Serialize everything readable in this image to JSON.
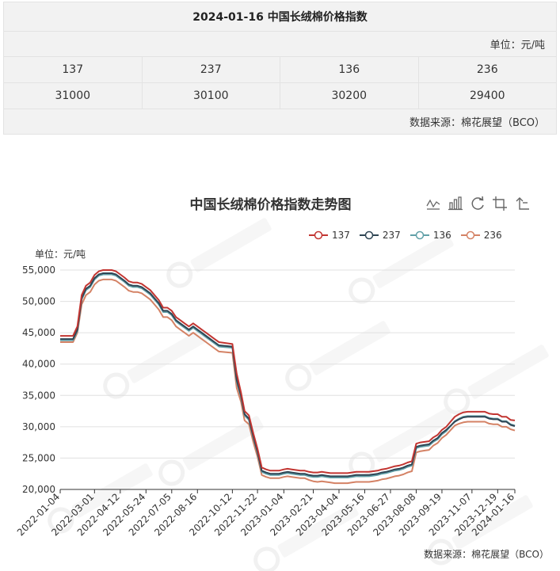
{
  "table": {
    "title": "2024-01-16 中国长绒棉价格指数",
    "unit": "单位：元/吨",
    "codes": [
      "137",
      "237",
      "136",
      "236"
    ],
    "values": [
      "31000",
      "30100",
      "30200",
      "29400"
    ],
    "source": "数据来源：棉花展望（BCO）"
  },
  "toolbox": {
    "icons": [
      "line-chart-icon",
      "bar-chart-icon",
      "restore-icon",
      "data-zoom-icon",
      "zoom-reset-icon"
    ]
  },
  "chart_data": {
    "type": "line",
    "title": "中国长绒棉价格指数走势图",
    "ylabel": "单位：元/吨",
    "source": "数据来源：棉花展望（BCO）",
    "ylim": [
      20000,
      55000
    ],
    "yticks": [
      "20,000",
      "25,000",
      "30,000",
      "35,000",
      "40,000",
      "45,000",
      "50,000",
      "55,000"
    ],
    "x_ticks": [
      "2022-01-04",
      "2022-03-01",
      "2022-04-12",
      "2022-05-24",
      "2022-07-05",
      "2022-08-16",
      "2022-10-12",
      "2022-11-22",
      "2023-01-04",
      "2023-02-21",
      "2023-04-04",
      "2023-05-16",
      "2023-06-27",
      "2023-08-08",
      "2023-09-19",
      "2023-11-07",
      "2023-12-19",
      "2024-01-16"
    ],
    "grid": true,
    "legend_position": "top-right",
    "colors": {
      "137": "#c23531",
      "237": "#2f4554",
      "136": "#61a0a8",
      "236": "#d48265"
    },
    "x": [
      "2022-01-04",
      "2022-01-18",
      "2022-01-25",
      "2022-02-01",
      "2022-02-08",
      "2022-02-15",
      "2022-02-22",
      "2022-03-01",
      "2022-03-08",
      "2022-03-15",
      "2022-03-22",
      "2022-03-29",
      "2022-04-05",
      "2022-04-12",
      "2022-04-19",
      "2022-04-26",
      "2022-05-03",
      "2022-05-10",
      "2022-05-17",
      "2022-05-24",
      "2022-05-31",
      "2022-06-07",
      "2022-06-14",
      "2022-06-21",
      "2022-06-28",
      "2022-07-05",
      "2022-07-12",
      "2022-07-19",
      "2022-07-26",
      "2022-08-02",
      "2022-08-09",
      "2022-08-16",
      "2022-08-23",
      "2022-08-30",
      "2022-09-06",
      "2022-09-13",
      "2022-09-20",
      "2022-10-12",
      "2022-10-19",
      "2022-10-26",
      "2022-11-01",
      "2022-11-08",
      "2022-11-15",
      "2022-11-22",
      "2022-11-29",
      "2022-12-06",
      "2022-12-13",
      "2022-12-20",
      "2022-12-27",
      "2023-01-04",
      "2023-01-10",
      "2023-01-17",
      "2023-01-31",
      "2023-02-07",
      "2023-02-14",
      "2023-02-21",
      "2023-02-28",
      "2023-03-07",
      "2023-03-14",
      "2023-03-21",
      "2023-03-28",
      "2023-04-04",
      "2023-04-11",
      "2023-04-18",
      "2023-04-25",
      "2023-05-02",
      "2023-05-09",
      "2023-05-16",
      "2023-05-23",
      "2023-05-30",
      "2023-06-06",
      "2023-06-13",
      "2023-06-20",
      "2023-06-27",
      "2023-07-04",
      "2023-07-11",
      "2023-07-18",
      "2023-07-25",
      "2023-08-01",
      "2023-08-08",
      "2023-08-15",
      "2023-08-22",
      "2023-08-29",
      "2023-09-05",
      "2023-09-12",
      "2023-09-19",
      "2023-09-26",
      "2023-10-10",
      "2023-10-17",
      "2023-10-24",
      "2023-10-31",
      "2023-11-07",
      "2023-11-14",
      "2023-11-21",
      "2023-11-28",
      "2023-12-05",
      "2023-12-12",
      "2023-12-19",
      "2023-12-26",
      "2024-01-02",
      "2024-01-09",
      "2024-01-16"
    ],
    "series": [
      {
        "name": "137",
        "values": [
          44500,
          44500,
          44500,
          46000,
          51000,
          52500,
          53000,
          54200,
          54800,
          55000,
          55000,
          55000,
          54800,
          54300,
          53800,
          53200,
          53000,
          53000,
          52800,
          52300,
          51800,
          51000,
          50200,
          49000,
          49000,
          48500,
          47500,
          47000,
          46500,
          46000,
          46500,
          46000,
          45500,
          45000,
          44500,
          44000,
          43500,
          43200,
          38500,
          35500,
          32500,
          31800,
          29000,
          26500,
          23500,
          23200,
          23000,
          23000,
          23000,
          23200,
          23300,
          23200,
          23000,
          23000,
          22800,
          22700,
          22700,
          22800,
          22700,
          22600,
          22600,
          22600,
          22600,
          22600,
          22700,
          22800,
          22800,
          22800,
          22800,
          22900,
          23000,
          23200,
          23300,
          23500,
          23700,
          23800,
          24000,
          24300,
          24500,
          27300,
          27500,
          27600,
          27700,
          28300,
          28700,
          29500,
          30000,
          31600,
          32000,
          32300,
          32400,
          32400,
          32400,
          32400,
          32400,
          32100,
          32000,
          32000,
          31600,
          31600,
          31100,
          31000
        ]
      },
      {
        "name": "237",
        "values": [
          44000,
          44000,
          44000,
          45500,
          50500,
          52000,
          52500,
          53700,
          54300,
          54500,
          54500,
          54500,
          54300,
          53800,
          53300,
          52700,
          52500,
          52500,
          52300,
          51800,
          51300,
          50500,
          49700,
          48500,
          48500,
          48000,
          47000,
          46500,
          46000,
          45500,
          46000,
          45500,
          45000,
          44500,
          44000,
          43500,
          43000,
          42800,
          37500,
          35000,
          32000,
          31300,
          28500,
          26000,
          23000,
          22700,
          22500,
          22500,
          22500,
          22700,
          22800,
          22700,
          22500,
          22500,
          22300,
          22200,
          22200,
          22300,
          22200,
          22100,
          22100,
          22100,
          22100,
          22100,
          22200,
          22300,
          22300,
          22300,
          22300,
          22400,
          22500,
          22700,
          22800,
          23000,
          23200,
          23300,
          23500,
          23800,
          24000,
          26800,
          27000,
          27100,
          27200,
          27800,
          28200,
          29000,
          29500,
          30800,
          31200,
          31500,
          31600,
          31600,
          31600,
          31600,
          31600,
          31300,
          31200,
          31200,
          30800,
          30800,
          30300,
          30100
        ]
      },
      {
        "name": "136",
        "values": [
          43800,
          43800,
          43800,
          45300,
          50300,
          51800,
          52300,
          53500,
          54100,
          54300,
          54300,
          54300,
          54100,
          53600,
          53100,
          52500,
          52300,
          52300,
          52100,
          51600,
          51100,
          50300,
          49500,
          48300,
          48300,
          47800,
          46800,
          46300,
          45800,
          45300,
          45800,
          45300,
          44800,
          44300,
          43800,
          43300,
          42800,
          42600,
          37200,
          34800,
          31800,
          31100,
          28300,
          25800,
          22800,
          22500,
          22300,
          22300,
          22300,
          22500,
          22600,
          22500,
          22300,
          22300,
          22100,
          22000,
          22000,
          22100,
          22000,
          21900,
          21900,
          21900,
          21900,
          21900,
          22000,
          22100,
          22100,
          22100,
          22100,
          22200,
          22300,
          22500,
          22600,
          22800,
          23000,
          23100,
          23300,
          23600,
          23800,
          26600,
          26800,
          26900,
          27000,
          27600,
          28000,
          28800,
          29300,
          30900,
          31300,
          31600,
          31700,
          31700,
          31700,
          31700,
          31700,
          31400,
          31300,
          31300,
          30900,
          30900,
          30400,
          30200
        ]
      },
      {
        "name": "236",
        "values": [
          43500,
          43500,
          43500,
          45000,
          49500,
          51000,
          51500,
          52700,
          53300,
          53500,
          53500,
          53500,
          53300,
          52800,
          52300,
          51700,
          51500,
          51500,
          51300,
          50800,
          50300,
          49500,
          48700,
          47500,
          47500,
          47000,
          46000,
          45500,
          45000,
          44500,
          45000,
          44500,
          44000,
          43500,
          43000,
          42500,
          42000,
          41800,
          36200,
          34000,
          31000,
          30400,
          27600,
          25200,
          22300,
          22000,
          21800,
          21800,
          21800,
          22000,
          22100,
          22000,
          21800,
          21800,
          21500,
          21300,
          21200,
          21300,
          21200,
          21100,
          21000,
          21000,
          21000,
          21000,
          21100,
          21200,
          21200,
          21200,
          21200,
          21300,
          21400,
          21600,
          21700,
          21900,
          22100,
          22200,
          22400,
          22700,
          22900,
          25900,
          26100,
          26200,
          26300,
          27000,
          27400,
          28200,
          28700,
          30200,
          30500,
          30700,
          30800,
          30800,
          30800,
          30800,
          30800,
          30500,
          30400,
          30400,
          30000,
          30000,
          29600,
          29400
        ]
      }
    ]
  }
}
